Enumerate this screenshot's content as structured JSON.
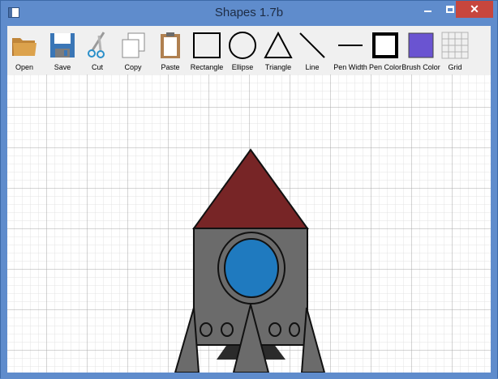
{
  "window": {
    "title": "Shapes 1.7b"
  },
  "titlebar_buttons": {
    "minimize": "minimize",
    "maximize": "maximize",
    "close": "✕"
  },
  "toolbar": {
    "tools": [
      {
        "label": "Open",
        "icon": "open-folder-icon"
      },
      {
        "label": "Save",
        "icon": "save-disk-icon"
      },
      {
        "label": "Cut",
        "icon": "scissors-icon"
      },
      {
        "label": "Copy",
        "icon": "copy-icon"
      },
      {
        "label": "Paste",
        "icon": "paste-clipboard-icon"
      },
      {
        "label": "Rectangle",
        "icon": "rectangle-icon"
      },
      {
        "label": "Ellipse",
        "icon": "ellipse-icon"
      },
      {
        "label": "Triangle",
        "icon": "triangle-icon"
      },
      {
        "label": "Line",
        "icon": "line-icon"
      },
      {
        "label": "Pen Width",
        "icon": "pen-width-icon"
      },
      {
        "label": "Pen Color",
        "icon": "pen-color-icon"
      },
      {
        "label": "Brush Color",
        "icon": "brush-color-icon"
      },
      {
        "label": "Grid",
        "icon": "grid-icon"
      }
    ]
  },
  "colors": {
    "titlebar": "#5f8ccc",
    "close_button": "#c7463d",
    "toolbar": "#f0f0f0",
    "grid_minor": "#e4e4e4",
    "grid_major": "#9a9a9a",
    "rocket_nose": "#772526",
    "rocket_body": "#6b6b6b",
    "rocket_window": "#1f7abf",
    "rocket_stand": "#2b2b2b",
    "brush_color": "#6a54d1"
  },
  "drawing": {
    "shapes": [
      {
        "kind": "triangle",
        "name": "rocket-nose",
        "color": "rocket_nose"
      },
      {
        "kind": "rectangle",
        "name": "rocket-body",
        "color": "rocket_body"
      },
      {
        "kind": "ellipse",
        "name": "rocket-window-ring",
        "color": "rocket_body"
      },
      {
        "kind": "ellipse",
        "name": "rocket-window-glass",
        "color": "rocket_window"
      },
      {
        "kind": "ellipse",
        "name": "rocket-porthole",
        "color": "rocket_body"
      },
      {
        "kind": "triangle",
        "name": "rocket-fin",
        "color": "rocket_body"
      },
      {
        "kind": "triangle",
        "name": "rocket-stand",
        "color": "rocket_stand"
      }
    ]
  }
}
